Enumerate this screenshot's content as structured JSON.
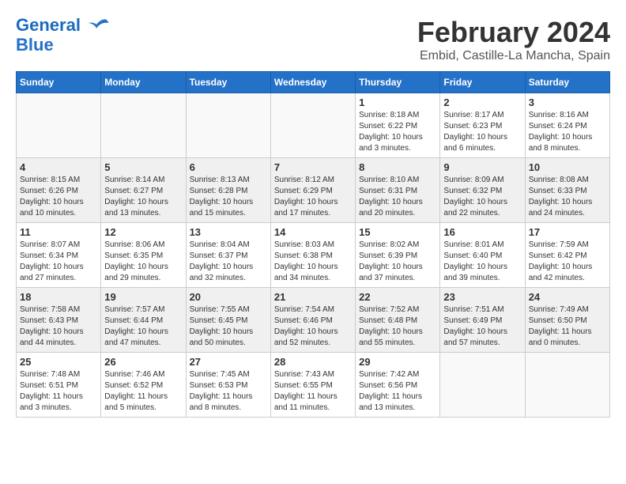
{
  "header": {
    "logo_line1": "General",
    "logo_line2": "Blue",
    "month_year": "February 2024",
    "location": "Embid, Castille-La Mancha, Spain"
  },
  "weekdays": [
    "Sunday",
    "Monday",
    "Tuesday",
    "Wednesday",
    "Thursday",
    "Friday",
    "Saturday"
  ],
  "weeks": [
    [
      {
        "day": "",
        "info": ""
      },
      {
        "day": "",
        "info": ""
      },
      {
        "day": "",
        "info": ""
      },
      {
        "day": "",
        "info": ""
      },
      {
        "day": "1",
        "info": "Sunrise: 8:18 AM\nSunset: 6:22 PM\nDaylight: 10 hours\nand 3 minutes."
      },
      {
        "day": "2",
        "info": "Sunrise: 8:17 AM\nSunset: 6:23 PM\nDaylight: 10 hours\nand 6 minutes."
      },
      {
        "day": "3",
        "info": "Sunrise: 8:16 AM\nSunset: 6:24 PM\nDaylight: 10 hours\nand 8 minutes."
      }
    ],
    [
      {
        "day": "4",
        "info": "Sunrise: 8:15 AM\nSunset: 6:26 PM\nDaylight: 10 hours\nand 10 minutes."
      },
      {
        "day": "5",
        "info": "Sunrise: 8:14 AM\nSunset: 6:27 PM\nDaylight: 10 hours\nand 13 minutes."
      },
      {
        "day": "6",
        "info": "Sunrise: 8:13 AM\nSunset: 6:28 PM\nDaylight: 10 hours\nand 15 minutes."
      },
      {
        "day": "7",
        "info": "Sunrise: 8:12 AM\nSunset: 6:29 PM\nDaylight: 10 hours\nand 17 minutes."
      },
      {
        "day": "8",
        "info": "Sunrise: 8:10 AM\nSunset: 6:31 PM\nDaylight: 10 hours\nand 20 minutes."
      },
      {
        "day": "9",
        "info": "Sunrise: 8:09 AM\nSunset: 6:32 PM\nDaylight: 10 hours\nand 22 minutes."
      },
      {
        "day": "10",
        "info": "Sunrise: 8:08 AM\nSunset: 6:33 PM\nDaylight: 10 hours\nand 24 minutes."
      }
    ],
    [
      {
        "day": "11",
        "info": "Sunrise: 8:07 AM\nSunset: 6:34 PM\nDaylight: 10 hours\nand 27 minutes."
      },
      {
        "day": "12",
        "info": "Sunrise: 8:06 AM\nSunset: 6:35 PM\nDaylight: 10 hours\nand 29 minutes."
      },
      {
        "day": "13",
        "info": "Sunrise: 8:04 AM\nSunset: 6:37 PM\nDaylight: 10 hours\nand 32 minutes."
      },
      {
        "day": "14",
        "info": "Sunrise: 8:03 AM\nSunset: 6:38 PM\nDaylight: 10 hours\nand 34 minutes."
      },
      {
        "day": "15",
        "info": "Sunrise: 8:02 AM\nSunset: 6:39 PM\nDaylight: 10 hours\nand 37 minutes."
      },
      {
        "day": "16",
        "info": "Sunrise: 8:01 AM\nSunset: 6:40 PM\nDaylight: 10 hours\nand 39 minutes."
      },
      {
        "day": "17",
        "info": "Sunrise: 7:59 AM\nSunset: 6:42 PM\nDaylight: 10 hours\nand 42 minutes."
      }
    ],
    [
      {
        "day": "18",
        "info": "Sunrise: 7:58 AM\nSunset: 6:43 PM\nDaylight: 10 hours\nand 44 minutes."
      },
      {
        "day": "19",
        "info": "Sunrise: 7:57 AM\nSunset: 6:44 PM\nDaylight: 10 hours\nand 47 minutes."
      },
      {
        "day": "20",
        "info": "Sunrise: 7:55 AM\nSunset: 6:45 PM\nDaylight: 10 hours\nand 50 minutes."
      },
      {
        "day": "21",
        "info": "Sunrise: 7:54 AM\nSunset: 6:46 PM\nDaylight: 10 hours\nand 52 minutes."
      },
      {
        "day": "22",
        "info": "Sunrise: 7:52 AM\nSunset: 6:48 PM\nDaylight: 10 hours\nand 55 minutes."
      },
      {
        "day": "23",
        "info": "Sunrise: 7:51 AM\nSunset: 6:49 PM\nDaylight: 10 hours\nand 57 minutes."
      },
      {
        "day": "24",
        "info": "Sunrise: 7:49 AM\nSunset: 6:50 PM\nDaylight: 11 hours\nand 0 minutes."
      }
    ],
    [
      {
        "day": "25",
        "info": "Sunrise: 7:48 AM\nSunset: 6:51 PM\nDaylight: 11 hours\nand 3 minutes."
      },
      {
        "day": "26",
        "info": "Sunrise: 7:46 AM\nSunset: 6:52 PM\nDaylight: 11 hours\nand 5 minutes."
      },
      {
        "day": "27",
        "info": "Sunrise: 7:45 AM\nSunset: 6:53 PM\nDaylight: 11 hours\nand 8 minutes."
      },
      {
        "day": "28",
        "info": "Sunrise: 7:43 AM\nSunset: 6:55 PM\nDaylight: 11 hours\nand 11 minutes."
      },
      {
        "day": "29",
        "info": "Sunrise: 7:42 AM\nSunset: 6:56 PM\nDaylight: 11 hours\nand 13 minutes."
      },
      {
        "day": "",
        "info": ""
      },
      {
        "day": "",
        "info": ""
      }
    ]
  ]
}
